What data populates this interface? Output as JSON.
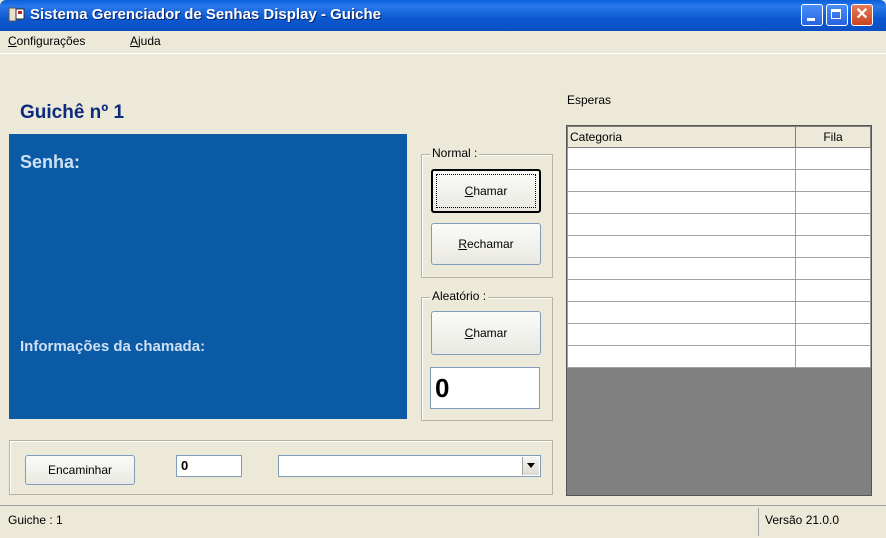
{
  "window": {
    "title": "Sistema Gerenciador de Senhas Display - Guiche",
    "close_glyph": "✕"
  },
  "menu": {
    "items": [
      {
        "label": "Configurações",
        "accel": "C",
        "rest": "onfigurações"
      },
      {
        "label": "Ajuda",
        "accel": "A",
        "rest": "juda"
      }
    ]
  },
  "panel": {
    "guiche_title": "Guichê nº 1",
    "senha_label": "Senha:",
    "info_label": "Informações da chamada:"
  },
  "normal_group": {
    "title": "Normal :",
    "chamar_accel": "C",
    "chamar_rest": "hamar",
    "rechamar_accel": "R",
    "rechamar_rest": "echamar"
  },
  "aleatorio_group": {
    "title": "Aleatório :",
    "chamar_accel": "C",
    "chamar_rest": "hamar",
    "number_value": "0"
  },
  "bottom": {
    "encaminhar_label": "Encaminhar",
    "number_value": "0",
    "combo_value": ""
  },
  "esperas": {
    "label": "Esperas",
    "columns": [
      "Categoria",
      "Fila"
    ],
    "rows": [
      [
        "",
        ""
      ],
      [
        "",
        ""
      ],
      [
        "",
        ""
      ],
      [
        "",
        ""
      ],
      [
        "",
        ""
      ],
      [
        "",
        ""
      ],
      [
        "",
        ""
      ],
      [
        "",
        ""
      ],
      [
        "",
        ""
      ],
      [
        "",
        ""
      ]
    ]
  },
  "status": {
    "left": "Guiche : 1",
    "right": "Versão 21.0.0"
  }
}
